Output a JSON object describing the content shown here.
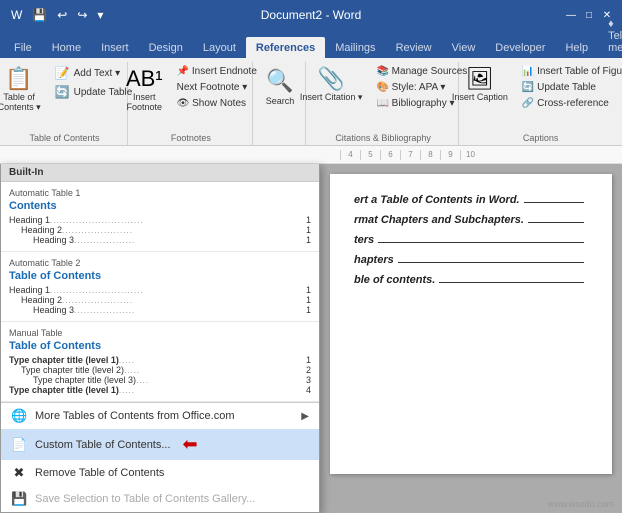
{
  "title_bar": {
    "title": "Document2 - Word",
    "quick_access": [
      "undo-icon",
      "redo-icon",
      "save-icon"
    ],
    "controls": [
      "minimize",
      "maximize",
      "close"
    ]
  },
  "ribbon": {
    "tabs": [
      "File",
      "Home",
      "Insert",
      "Design",
      "Layout",
      "References",
      "Mailings",
      "Review",
      "View",
      "Developer",
      "Help",
      "Tell me"
    ],
    "active_tab": "References",
    "groups": {
      "table_of_contents": {
        "label": "Table of Contents",
        "buttons": {
          "big": "Table of\nContents",
          "small": [
            "Add Text ▾",
            "Update Table"
          ]
        }
      },
      "footnotes": {
        "label": "Footnotes",
        "buttons": [
          "Insert Endnote",
          "Next Footnote ▾",
          "Show Notes"
        ],
        "big": "Insert\nFootnote"
      },
      "search": {
        "label": "Search"
      },
      "citations": {
        "label": "Citations & Bibliography",
        "buttons": [
          "Manage Sources",
          "Style: APA ▾",
          "Bibliography ▾"
        ],
        "big": "Insert\nCitation ▾"
      },
      "captions": {
        "label": "Captions",
        "buttons": [
          "Insert Table of Figu...",
          "Update Table",
          "Cross-reference"
        ],
        "big": "Insert\nCaption"
      }
    }
  },
  "toc_dropdown": {
    "section_header": "Built-In",
    "items": [
      {
        "type": "auto1",
        "subtitle": "Automatic Table 1",
        "title": "Contents",
        "entries": [
          {
            "label": "Heading 1",
            "dots": true,
            "page": "1",
            "indent": 0
          },
          {
            "label": "Heading 2",
            "dots": true,
            "page": "1",
            "indent": 1
          },
          {
            "label": "Heading 3",
            "dots": true,
            "page": "1",
            "indent": 2
          }
        ]
      },
      {
        "type": "auto2",
        "subtitle": "Automatic Table 2",
        "title": "Table of Contents",
        "entries": [
          {
            "label": "Heading 1",
            "dots": true,
            "page": "1",
            "indent": 0
          },
          {
            "label": "Heading 2",
            "dots": true,
            "page": "1",
            "indent": 1
          },
          {
            "label": "Heading 3",
            "dots": true,
            "page": "1",
            "indent": 2
          }
        ]
      },
      {
        "type": "manual",
        "subtitle": "Manual Table",
        "title": "Table of Contents",
        "entries": [
          {
            "label": "Type chapter title (level 1)",
            "dots": true,
            "page": "1",
            "indent": 0,
            "bold": true
          },
          {
            "label": "Type chapter title (level 2)",
            "dots": true,
            "page": "2",
            "indent": 1
          },
          {
            "label": "Type chapter title (level 3)",
            "dots": true,
            "page": "3",
            "indent": 2
          },
          {
            "label": "Type chapter title (level 1)",
            "dots": true,
            "page": "4",
            "indent": 0,
            "bold": true
          }
        ]
      }
    ],
    "menu_items": [
      {
        "icon": "🌐",
        "label": "More Tables of Contents from Office.com",
        "arrow": "▶",
        "disabled": false
      },
      {
        "icon": "📄",
        "label": "Custom Table of Contents...",
        "active": true
      },
      {
        "icon": "❌",
        "label": "Remove Table of Contents",
        "disabled": false
      },
      {
        "icon": "💾",
        "label": "Save Selection to Table of Contents Gallery...",
        "disabled": true
      }
    ]
  },
  "document": {
    "lines": [
      {
        "text": "ert a Table of Contents in Word.",
        "has_line": true
      },
      {
        "text": "rmat Chapters and Subchapters.",
        "has_line": true
      },
      {
        "text": "ters",
        "has_line": true
      },
      {
        "text": "hapters",
        "has_line": true
      },
      {
        "text": "ble of contents.",
        "has_line": true
      }
    ]
  },
  "ruler": {
    "marks": [
      "4",
      "5",
      "6",
      "7",
      "8",
      "9",
      "10"
    ]
  },
  "watermark": "www.wsxdn.com"
}
